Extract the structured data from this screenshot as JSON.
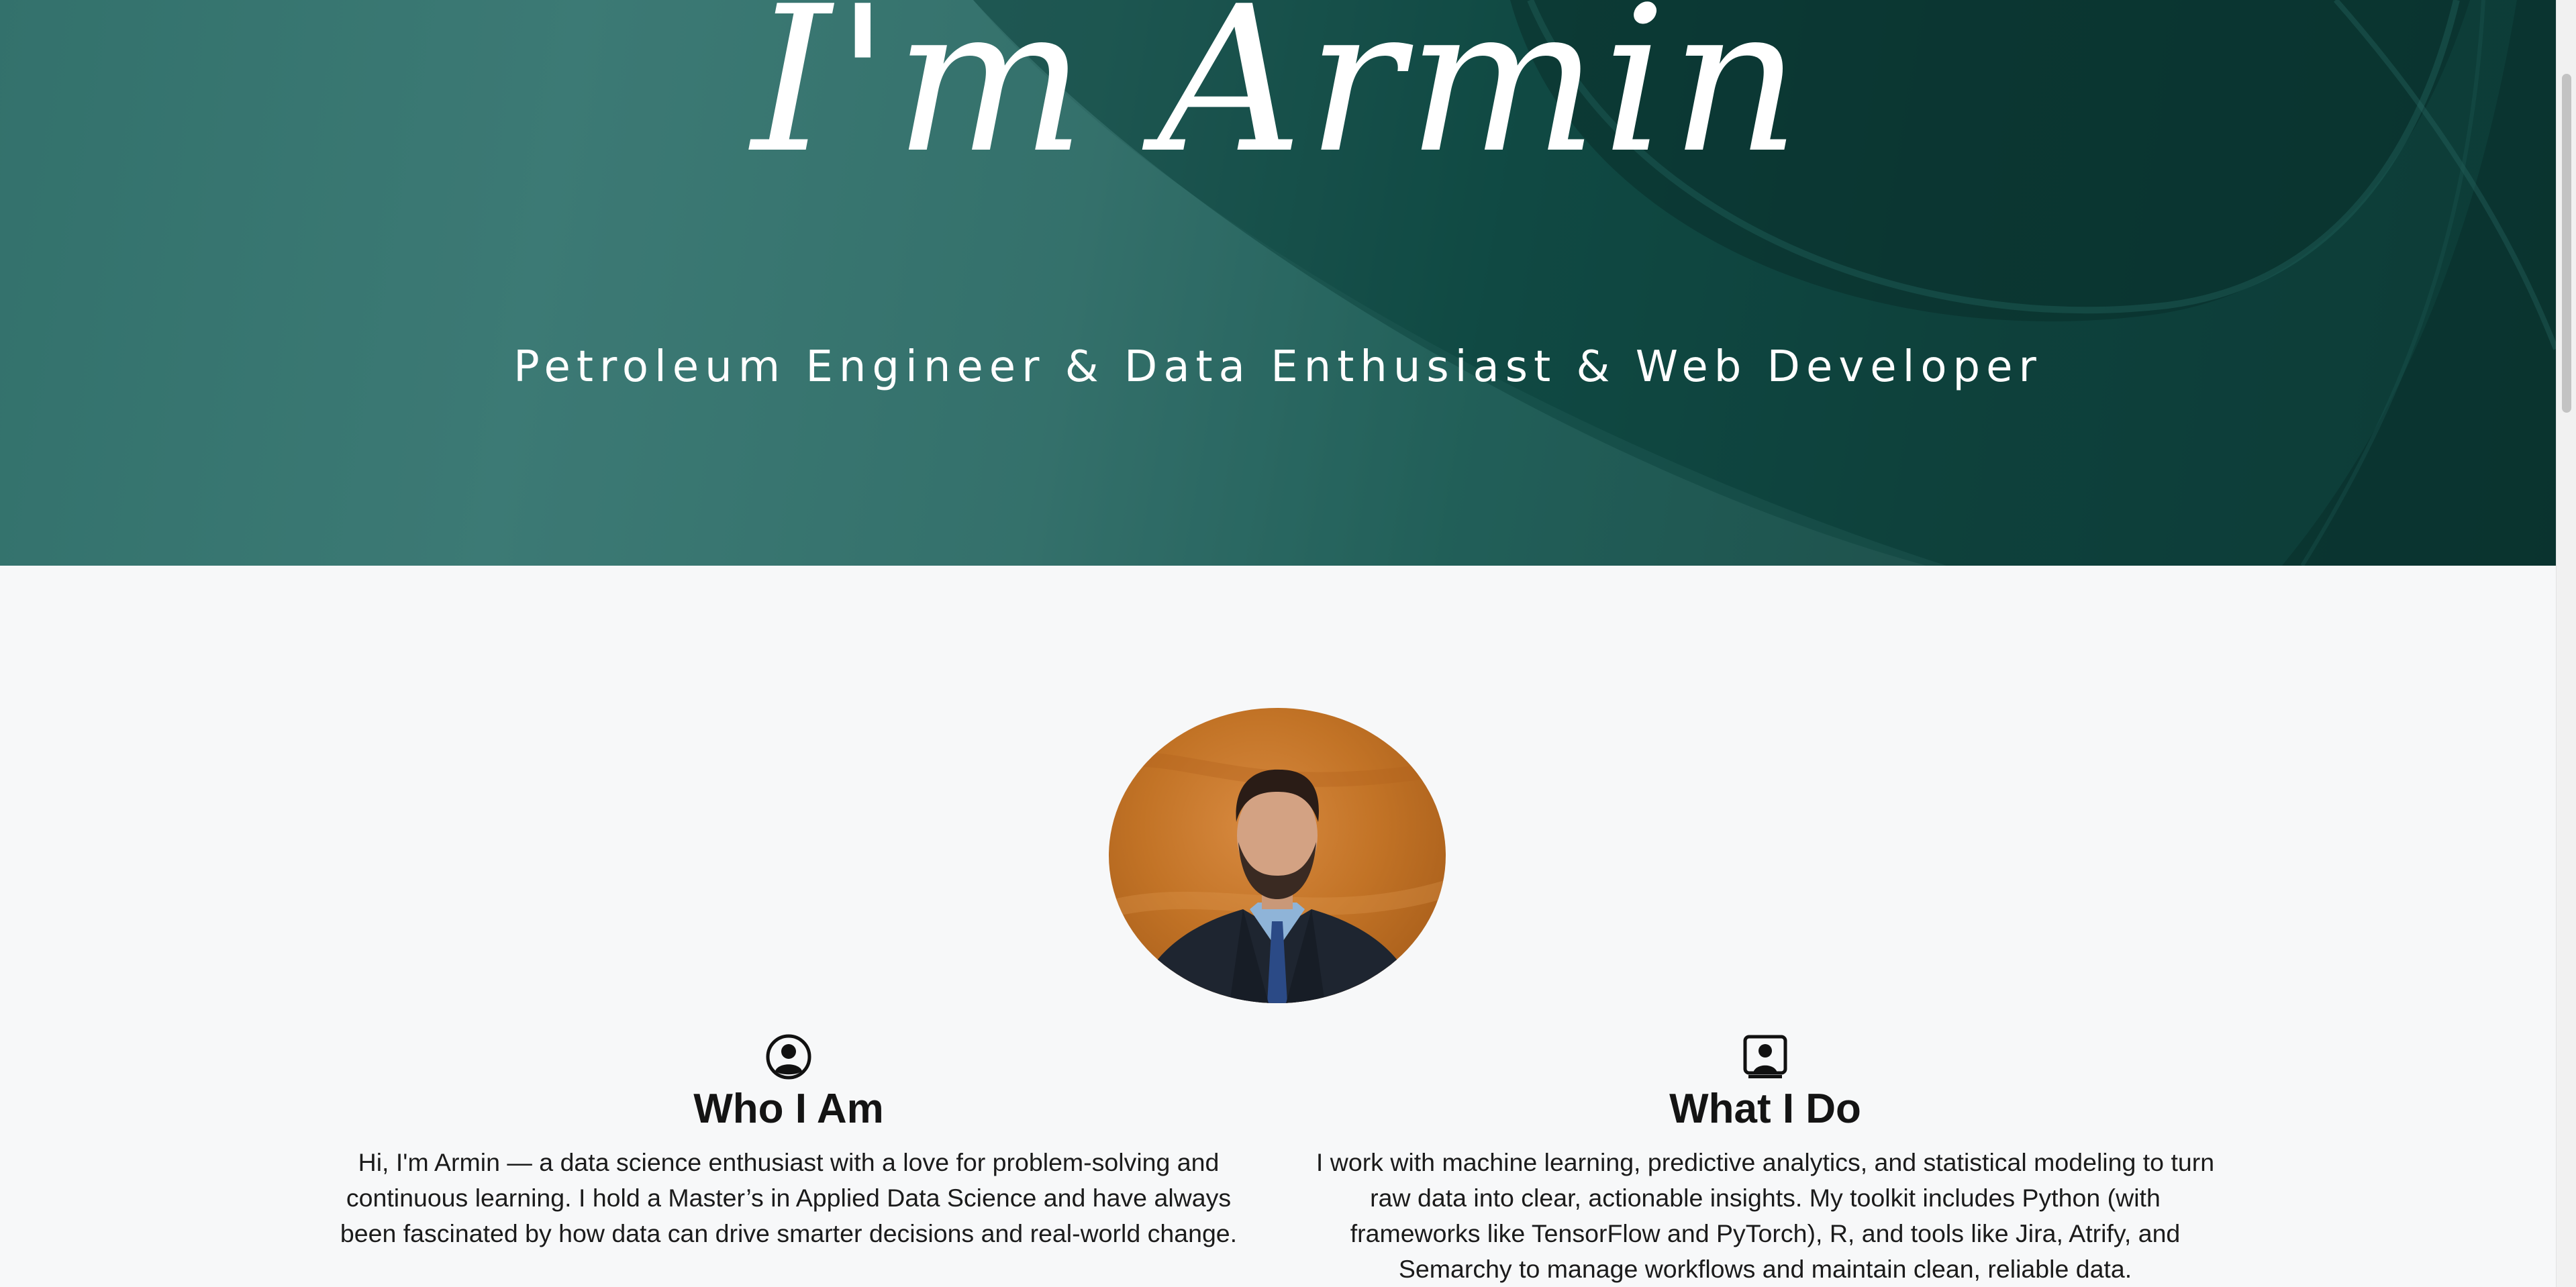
{
  "hero": {
    "title": "I'm Armin",
    "subtitle": "Petroleum Engineer & Data Enthusiast & Web Developer"
  },
  "profile": {
    "avatar_icon": "person-photo"
  },
  "sections": [
    {
      "icon": "person-circle-icon",
      "title": "Who I Am",
      "text": "Hi, I'm Armin — a data science enthusiast with a love for problem-solving and continuous learning. I hold a Master’s in Applied Data Science and have always been fascinated by how data can drive smarter decisions and real-world change."
    },
    {
      "icon": "person-video-icon",
      "title": "What I Do",
      "text": "I work with machine learning, predictive analytics, and statistical modeling to turn raw data into clear, actionable insights. My toolkit includes Python (with frameworks like TensorFlow and PyTorch), R, and tools like Jira, Atrify, and Semarchy to manage workflows and maintain clean, reliable data."
    }
  ],
  "colors": {
    "hero_dark": "#0b302d",
    "hero_mid": "#2f6a65",
    "hero_light": "#3b7873",
    "page_background": "#f7f8f9",
    "text": "#141414"
  }
}
